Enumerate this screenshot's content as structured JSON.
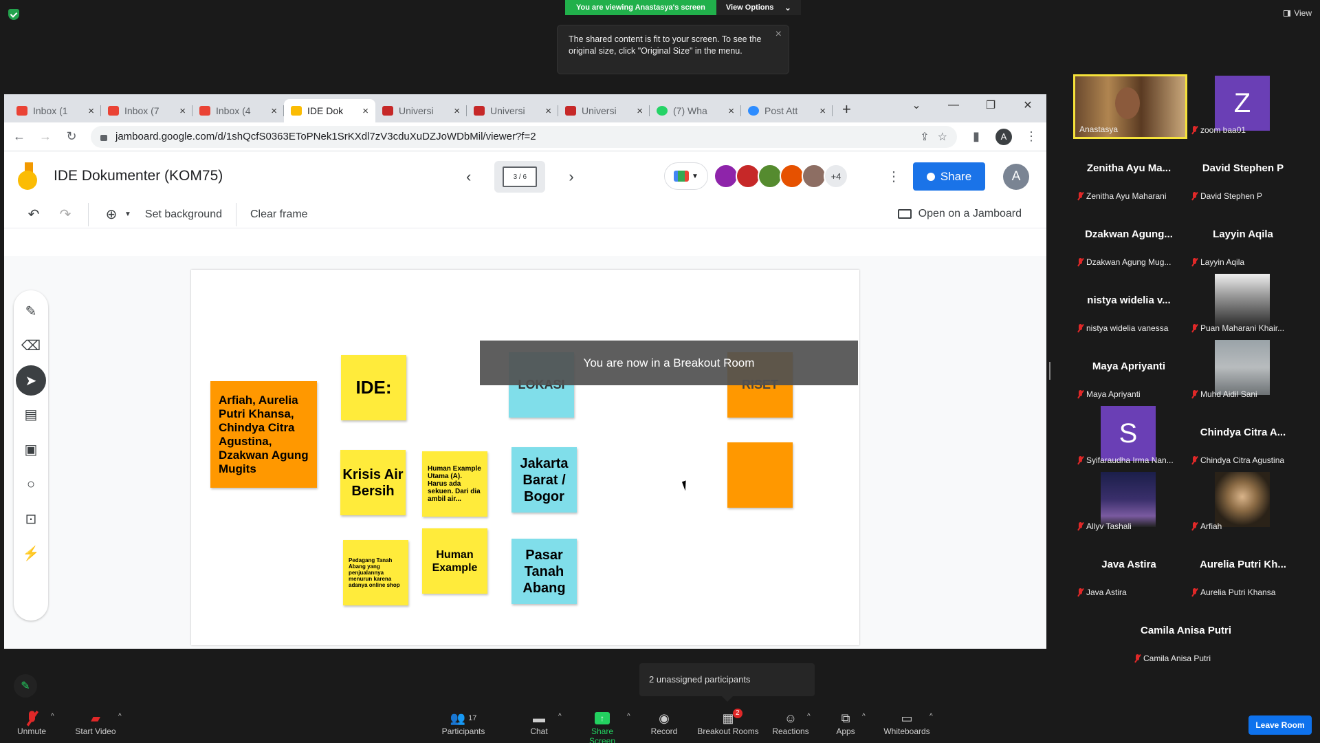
{
  "zoom_top": {
    "viewing_text": "You are viewing Anastasya's screen",
    "view_options": "View Options",
    "view_label": "View",
    "tooltip_text": "The shared content is fit to your screen. To see the original size, click \"Original Size\" in the menu."
  },
  "browser": {
    "tabs": [
      {
        "title": "Inbox (1",
        "favicon_color": "#ea4335"
      },
      {
        "title": "Inbox (7",
        "favicon_color": "#ea4335"
      },
      {
        "title": "Inbox (4",
        "favicon_color": "#ea4335"
      },
      {
        "title": "IDE Dok",
        "favicon_color": "#fbbc04"
      },
      {
        "title": "Universi",
        "favicon_color": "#c62828"
      },
      {
        "title": "Universi",
        "favicon_color": "#c62828"
      },
      {
        "title": "Universi",
        "favicon_color": "#c62828"
      },
      {
        "title": "(7) Wha",
        "favicon_color": "#25d366"
      },
      {
        "title": "Post Att",
        "favicon_color": "#2d8cff"
      }
    ],
    "url": "jamboard.google.com/d/1shQcfS0363EToPNek1SrKXdl7zV3cduXuDZJoWDbMil/viewer?f=2",
    "profile_initial": "A"
  },
  "jamboard": {
    "title": "IDE Dokumenter (KOM75)",
    "frame_counter": "3 / 6",
    "more_collaborators": "+4",
    "share_label": "Share",
    "account_initial": "A",
    "set_background": "Set background",
    "clear_frame": "Clear frame",
    "open_on_jamboard": "Open on a Jamboard",
    "notes": {
      "names": "Arfiah, Aurelia Putri Khansa, Chindya Citra Agustina, Dzakwan Agung Mugits",
      "ide": "IDE:",
      "lokasi": "LOKASI",
      "riset": "RISET",
      "krisis": "Krisis Air Bersih",
      "human_small": "Human Example Utama (A). Harus ada sekuen. Dari dia ambil air...",
      "jakarta": "Jakarta Barat / Bogor",
      "pedagang": "Pedagang Tanah Abang yang penjualannya menurun karena adanya online shop",
      "human_example": "Human Example",
      "pasar": "Pasar Tanah Abang"
    },
    "breakout_banner": "You are now in a Breakout Room"
  },
  "gallery": [
    {
      "name": "",
      "label": "Anastasya",
      "type": "video"
    },
    {
      "name": "",
      "label": "zoom baa01",
      "type": "letter",
      "letter": "Z",
      "color": "#6a3fb5"
    },
    {
      "name": "Zenitha Ayu Ma...",
      "label": "Zenitha Ayu Maharani",
      "type": "name"
    },
    {
      "name": "David Stephen P",
      "label": "David Stephen P",
      "type": "name"
    },
    {
      "name": "Dzakwan Agung...",
      "label": "Dzakwan Agung Mug...",
      "type": "name"
    },
    {
      "name": "Layyin Aqila",
      "label": "Layyin Aqila",
      "type": "name"
    },
    {
      "name": "nistya widelia v...",
      "label": "nistya widelia vanessa",
      "type": "name"
    },
    {
      "name": "",
      "label": "Puan Maharani Khair...",
      "type": "image"
    },
    {
      "name": "Maya Apriyanti",
      "label": "Maya Apriyanti",
      "type": "name"
    },
    {
      "name": "",
      "label": "Muhd Aidil Sani",
      "type": "image"
    },
    {
      "name": "",
      "label": "Syifaraudha Irma Nan...",
      "type": "letter",
      "letter": "S",
      "color": "#6a3fb5"
    },
    {
      "name": "Chindya Citra A...",
      "label": "Chindya Citra Agustina",
      "type": "name"
    },
    {
      "name": "",
      "label": "Allyv Tashali",
      "type": "image"
    },
    {
      "name": "",
      "label": "Arfiah",
      "type": "image"
    },
    {
      "name": "Java Astira",
      "label": "Java Astira",
      "type": "name"
    },
    {
      "name": "Aurelia Putri Kh...",
      "label": "Aurelia Putri Khansa",
      "type": "name"
    },
    {
      "name": "Camila Anisa Putri",
      "label": "Camila Anisa Putri",
      "type": "name"
    }
  ],
  "unassigned_text": "2 unassigned participants",
  "bottom_bar": {
    "unmute": "Unmute",
    "start_video": "Start Video",
    "participants": "Participants",
    "participants_count": "17",
    "chat": "Chat",
    "share_screen": "Share Screen",
    "record": "Record",
    "breakout_rooms": "Breakout Rooms",
    "breakout_badge": "2",
    "reactions": "Reactions",
    "apps": "Apps",
    "whiteboards": "Whiteboards",
    "leave_room": "Leave Room"
  }
}
